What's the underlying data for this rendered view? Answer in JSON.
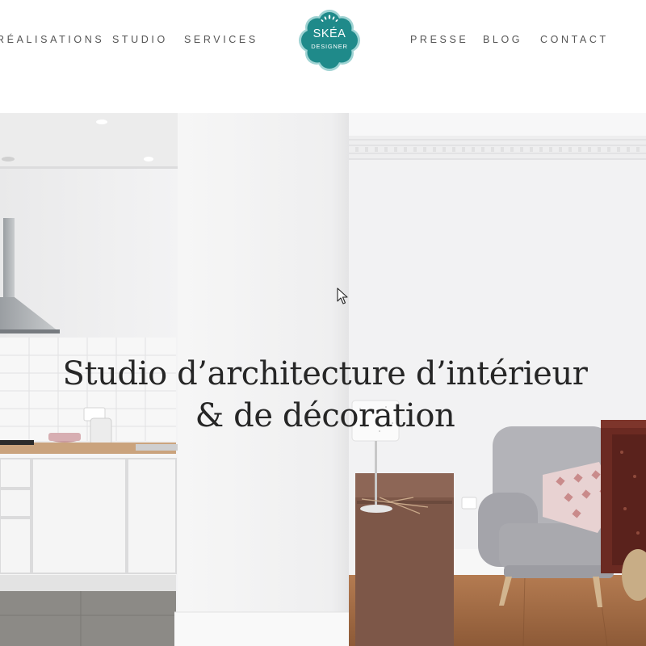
{
  "nav": {
    "left": [
      "RÉALISATIONS",
      "STUDIO",
      "SERVICES"
    ],
    "right": [
      "PRESSE",
      "BLOG",
      "CONTACT"
    ]
  },
  "logo": {
    "line1": "SKÉA",
    "line2": "DESIGNER",
    "color": "#1f8a8a"
  },
  "hero": {
    "title_line1": "Studio d’architecture d’intérieur",
    "title_line2": "& de décoration"
  },
  "colors": {
    "title": "#262626",
    "nav": "#555555",
    "brand": "#1f8a8a"
  }
}
